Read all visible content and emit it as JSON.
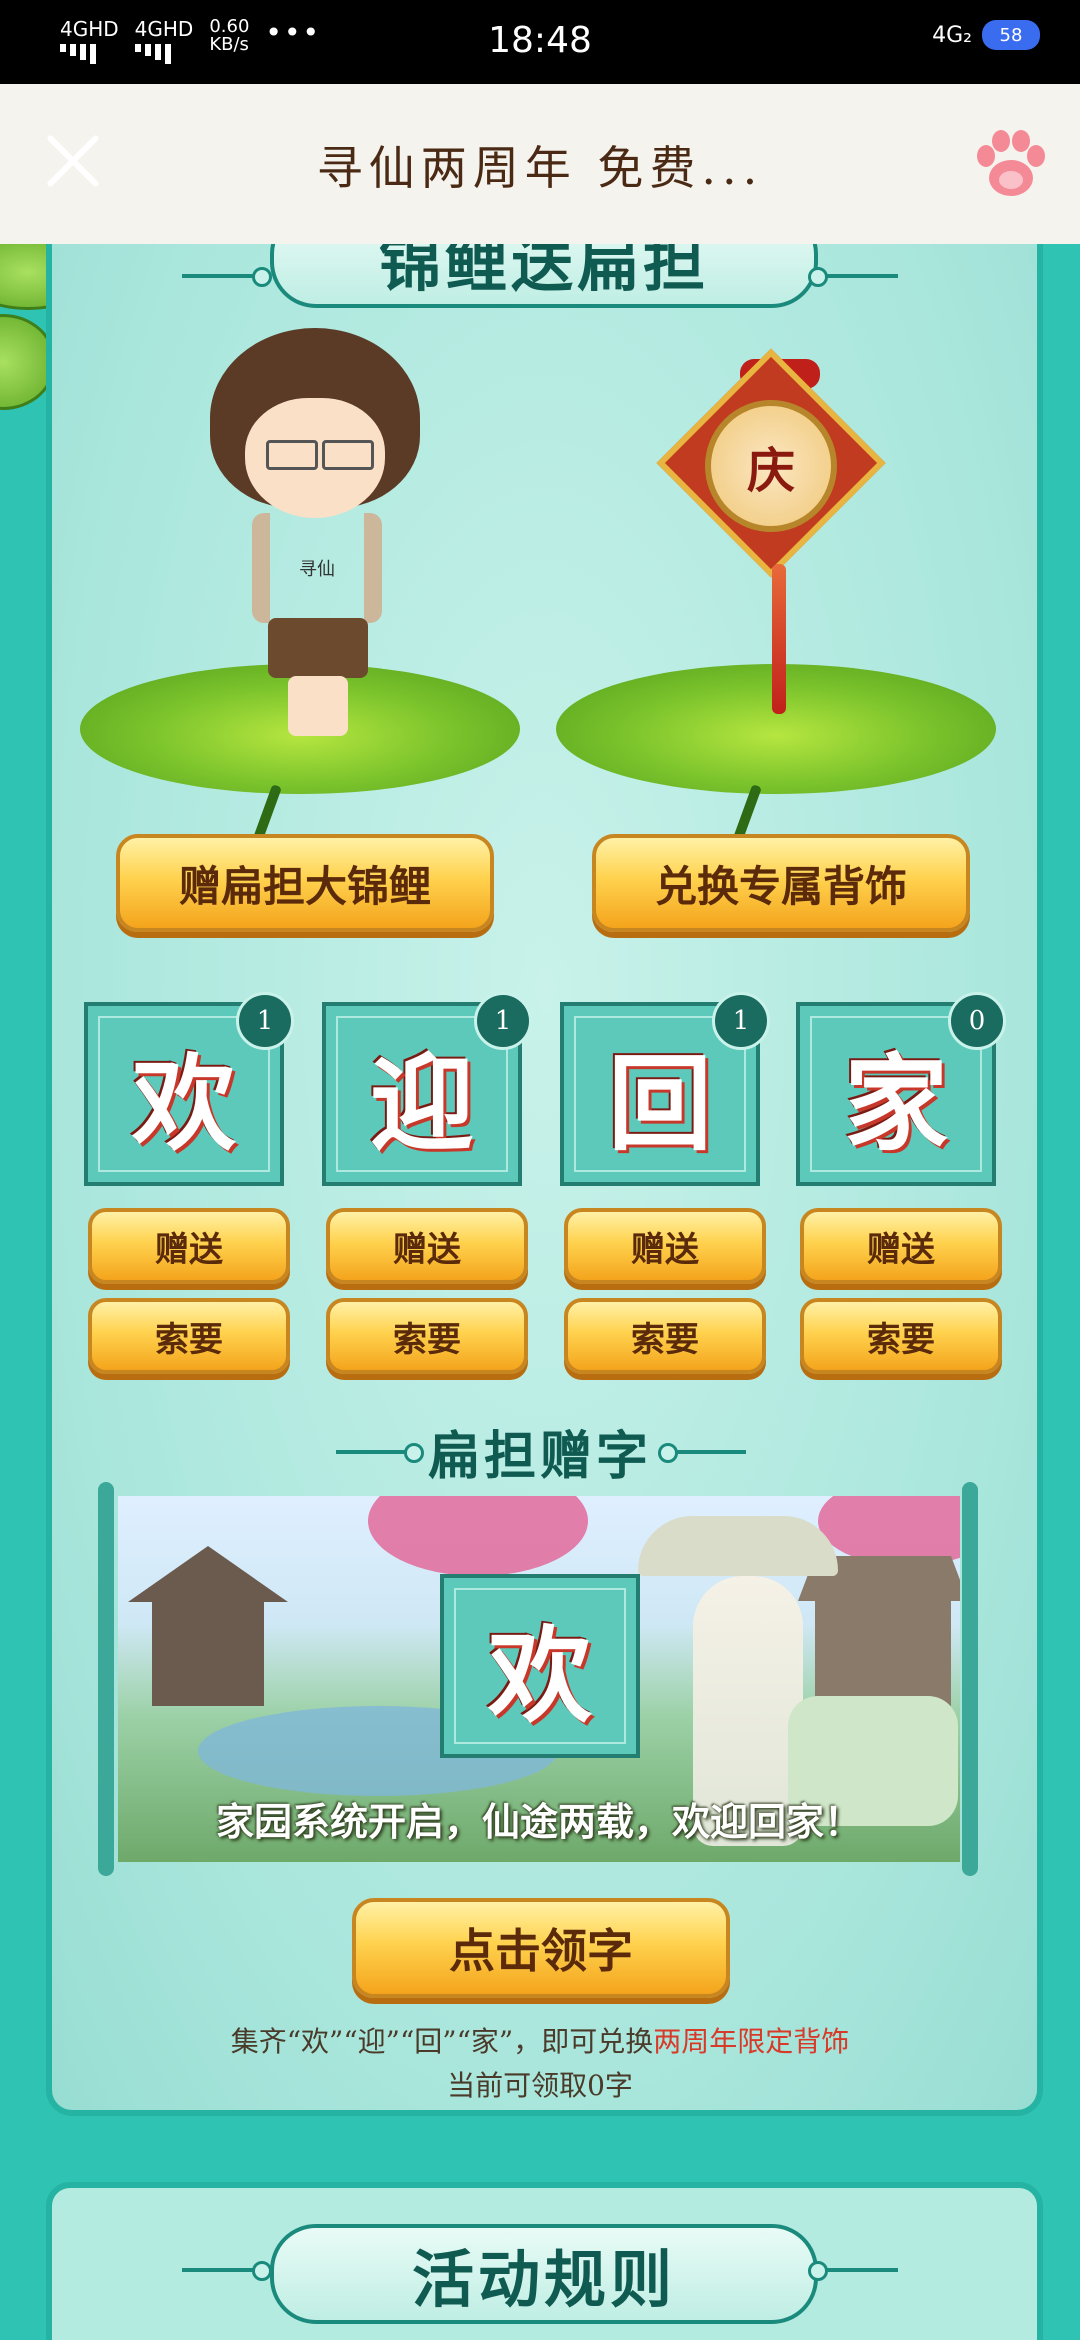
{
  "status_bar": {
    "sim1": "4GHD",
    "sim2": "4GHD",
    "net_speed": "0.60",
    "net_unit": "KB/s",
    "more": "•••",
    "time": "18:48",
    "network": "4G₂",
    "battery": "58"
  },
  "header": {
    "title": "寻仙两周年 免费..."
  },
  "section1": {
    "title": "锦鲤送扁担",
    "left_button": "赠扁担大锦鲤",
    "right_button": "兑换专属背饰",
    "ornament_char": "庆",
    "shirt_text": "寻仙"
  },
  "cards": [
    {
      "char": "欢",
      "count": "1",
      "give": "赠送",
      "ask": "索要"
    },
    {
      "char": "迎",
      "count": "1",
      "give": "赠送",
      "ask": "索要"
    },
    {
      "char": "回",
      "count": "1",
      "give": "赠送",
      "ask": "索要"
    },
    {
      "char": "家",
      "count": "0",
      "give": "赠送",
      "ask": "索要"
    }
  ],
  "section2": {
    "title": "扁担赠字",
    "scene_char": "欢",
    "caption": "家园系统开启，仙途两载，欢迎回家！",
    "claim_button": "点击领字",
    "note_prefix": "集齐“欢”“迎”“回”“家”，即可兑换",
    "note_highlight": "两周年限定背饰",
    "note_line2": "当前可领取0字"
  },
  "section3": {
    "title": "活动规则"
  },
  "colors": {
    "teal": "#2ec3b3",
    "panel": "#b3ebe1",
    "dark_teal": "#0f5b52",
    "gold": "#ffd24e",
    "highlight": "#d83a2a"
  }
}
